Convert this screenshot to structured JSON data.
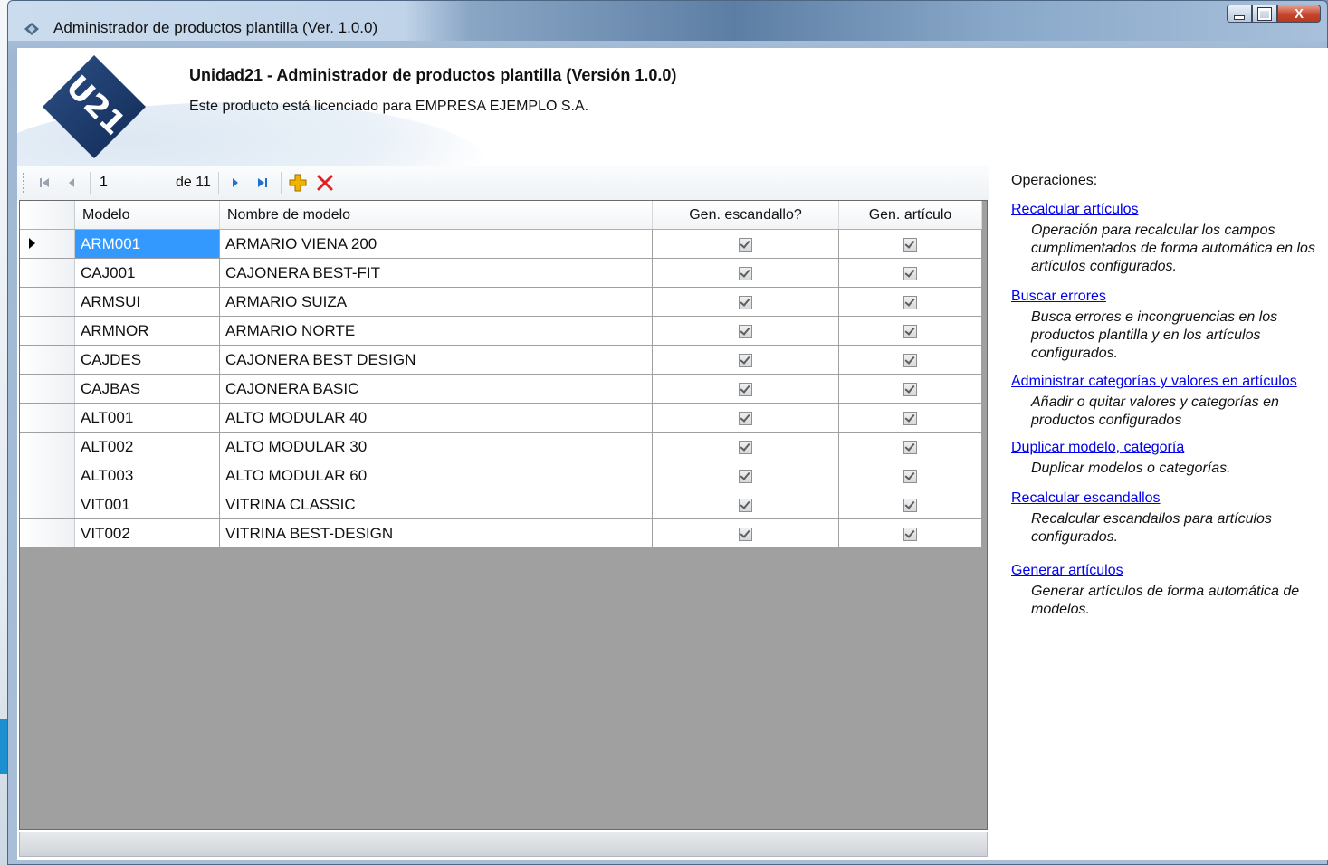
{
  "window": {
    "title": "Administrador de productos plantilla (Ver. 1.0.0)",
    "close_glyph": "X"
  },
  "header": {
    "logo_text": "U21",
    "title": "Unidad21 - Administrador de productos plantilla (Versión 1.0.0)",
    "license": "Este producto está licenciado para EMPRESA EJEMPLO S.A."
  },
  "navigator": {
    "position": "1",
    "of_label": "de 11"
  },
  "grid": {
    "columns": [
      "Modelo",
      "Nombre de modelo",
      "Gen. escandallo?",
      "Gen. artículo"
    ],
    "rows": [
      {
        "modelo": "ARM001",
        "nombre": "ARMARIO VIENA 200",
        "gen_escandallo": true,
        "gen_articulo": true
      },
      {
        "modelo": "CAJ001",
        "nombre": "CAJONERA BEST-FIT",
        "gen_escandallo": true,
        "gen_articulo": true
      },
      {
        "modelo": "ARMSUI",
        "nombre": "ARMARIO SUIZA",
        "gen_escandallo": true,
        "gen_articulo": true
      },
      {
        "modelo": "ARMNOR",
        "nombre": "ARMARIO NORTE",
        "gen_escandallo": true,
        "gen_articulo": true
      },
      {
        "modelo": "CAJDES",
        "nombre": "CAJONERA BEST DESIGN",
        "gen_escandallo": true,
        "gen_articulo": true
      },
      {
        "modelo": "CAJBAS",
        "nombre": "CAJONERA BASIC",
        "gen_escandallo": true,
        "gen_articulo": true
      },
      {
        "modelo": "ALT001",
        "nombre": "ALTO MODULAR 40",
        "gen_escandallo": true,
        "gen_articulo": true
      },
      {
        "modelo": "ALT002",
        "nombre": "ALTO MODULAR 30",
        "gen_escandallo": true,
        "gen_articulo": true
      },
      {
        "modelo": "ALT003",
        "nombre": "ALTO MODULAR 60",
        "gen_escandallo": true,
        "gen_articulo": true
      },
      {
        "modelo": "VIT001",
        "nombre": "VITRINA CLASSIC",
        "gen_escandallo": true,
        "gen_articulo": true
      },
      {
        "modelo": "VIT002",
        "nombre": "VITRINA BEST-DESIGN",
        "gen_escandallo": true,
        "gen_articulo": true
      }
    ]
  },
  "operations": {
    "title": "Operaciones:",
    "items": [
      {
        "link": "Recalcular artículos",
        "desc": "Operación para recalcular los campos cumplimentados de forma automática en los artículos configurados."
      },
      {
        "link": "Buscar errores",
        "desc": "Busca errores e incongruencias en los productos plantilla y en los artículos configurados."
      },
      {
        "link": "Administrar categorías y valores en artículos",
        "desc": "Añadir o quitar valores y categorías en productos configurados"
      },
      {
        "link": "Duplicar modelo, categoría",
        "desc": "Duplicar modelos o categorías."
      },
      {
        "link": "Recalcular escandallos",
        "desc": "Recalcular escandallos para artículos configurados."
      },
      {
        "link": "Generar artículos",
        "desc": "Generar artículos de forma automática de modelos."
      }
    ]
  },
  "colors": {
    "selection": "#3399ff",
    "link": "#0000ee",
    "delete_icon": "#e02020",
    "add_icon": "#f0b400",
    "nav_icon": "#1f6fd1"
  }
}
